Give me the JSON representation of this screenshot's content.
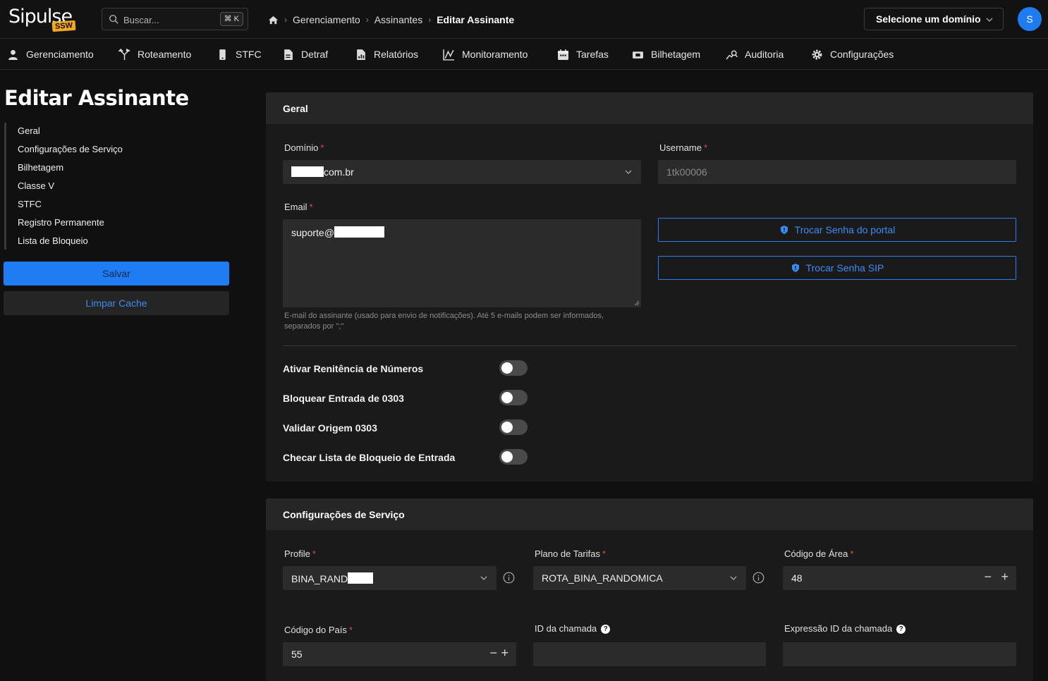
{
  "topbar": {
    "logo_text": "Sipulse",
    "logo_badge": "SSW",
    "search_placeholder": "Buscar...",
    "search_shortcut": "⌘ K",
    "domain_select": "Selecione um domínio",
    "avatar_initial": "S"
  },
  "breadcrumb": [
    "Gerenciamento",
    "Assinantes",
    "Editar Assinante"
  ],
  "nav": [
    {
      "label": "Gerenciamento",
      "icon": "user-icon"
    },
    {
      "label": "Roteamento",
      "icon": "routing-icon"
    },
    {
      "label": "STFC",
      "icon": "phone-icon"
    },
    {
      "label": "Detraf",
      "icon": "document-icon"
    },
    {
      "label": "Relatórios",
      "icon": "report-icon"
    },
    {
      "label": "Monitoramento",
      "icon": "chart-icon"
    },
    {
      "label": "Tarefas",
      "icon": "calendar-icon"
    },
    {
      "label": "Bilhetagem",
      "icon": "ticket-icon"
    },
    {
      "label": "Auditoria",
      "icon": "audit-icon"
    },
    {
      "label": "Configurações",
      "icon": "gear-icon"
    }
  ],
  "page_title": "Editar Assinante",
  "side_nav": [
    "Geral",
    "Configurações de Serviço",
    "Bilhetagem",
    "Classe V",
    "STFC",
    "Registro Permanente",
    "Lista de Bloqueio"
  ],
  "actions": {
    "save": "Salvar",
    "clear_cache": "Limpar Cache"
  },
  "geral": {
    "title": "Geral",
    "domain_label": "Domínio",
    "domain_value": "com.br",
    "username_label": "Username",
    "username_value": "1tk00006",
    "email_label": "Email",
    "email_value": "suporte@",
    "email_help": "E-mail do assinante (usado para envio de notificações). Até 5 e-mails podem ser informados, separados por \";\"",
    "btn_portal_password": "Trocar Senha do portal",
    "btn_sip_password": "Trocar Senha SIP",
    "toggles": [
      {
        "label": "Ativar Renitência de Números",
        "on": false
      },
      {
        "label": "Bloquear Entrada de 0303",
        "on": false
      },
      {
        "label": "Validar Origem 0303",
        "on": false
      },
      {
        "label": "Checar Lista de Bloqueio de Entrada",
        "on": false
      }
    ]
  },
  "servico": {
    "title": "Configurações de Serviço",
    "profile_label": "Profile",
    "profile_value": "BINA_RAND",
    "tariff_label": "Plano de Tarifas",
    "tariff_value": "ROTA_BINA_RANDOMICA",
    "area_code_label": "Código de Área",
    "area_code_value": "48",
    "country_code_label": "Código do País",
    "country_code_value": "55",
    "caller_id_label": "ID da chamada",
    "caller_id_value": "",
    "caller_id_expr_label": "Expressão ID da chamada",
    "caller_id_expr_value": ""
  },
  "required_mark": "*",
  "stepper_minus": "−",
  "stepper_plus": "+"
}
